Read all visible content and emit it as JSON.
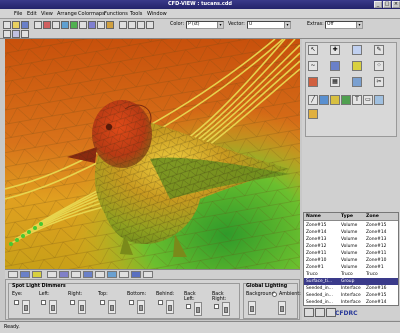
{
  "window": {
    "title": "CFD-VIEW : tucans.cdd",
    "controls": [
      "_",
      "□",
      "×"
    ]
  },
  "menu": [
    "File",
    "Edit",
    "View",
    "Arrange",
    "Colormaps",
    "Functions",
    "Tools",
    "Window"
  ],
  "toolbar": {
    "color_label": "Color:",
    "color_value": "P (st)",
    "vector_label": "Vector:",
    "vector_value": "U",
    "extras_label": "Extras:",
    "extras_value": "Off"
  },
  "lighting": {
    "title": "Spot Light Dimmers",
    "eye": "Eye:",
    "left": "Left:",
    "right": "Right:",
    "top": "Top:",
    "bottom": "Bottom:",
    "behind": "Behind:",
    "back_left": "Back Left:",
    "back_right": "Back Right:",
    "global_title": "Global Lighting",
    "background": "Background:",
    "ambient": "Ambient:"
  },
  "table": {
    "headers": [
      "Name",
      "Type",
      "Zone"
    ],
    "rows": [
      [
        "Zone#15",
        "Volume",
        "Zone#15"
      ],
      [
        "Zone#14",
        "Volume",
        "Zone#14"
      ],
      [
        "Zone#13",
        "Volume",
        "Zone#13"
      ],
      [
        "Zone#12",
        "Volume",
        "Zone#12"
      ],
      [
        "Zone#11",
        "Volume",
        "Zone#11"
      ],
      [
        "Zone#10",
        "Volume",
        "Zone#10"
      ],
      [
        "Zone#1",
        "Volume",
        "Zone#1"
      ],
      [
        "Truco",
        "Truco",
        "Truco"
      ],
      [
        "Surface_ti...",
        "Group",
        ""
      ],
      [
        "Seeded_in...",
        "Interface",
        "Zone#16"
      ],
      [
        "Seeded_in...",
        "Interface",
        "Zone#15"
      ],
      [
        "Seeded_in...",
        "Interface",
        "Zone#14"
      ]
    ],
    "selected_index": 8
  },
  "status": "Ready.",
  "logo": "CFDRC",
  "colors": {
    "accent": "#3a3a8a",
    "surface_hot": "#d4a020",
    "field_green": "#4fb82a",
    "field_orange": "#d86a10"
  }
}
